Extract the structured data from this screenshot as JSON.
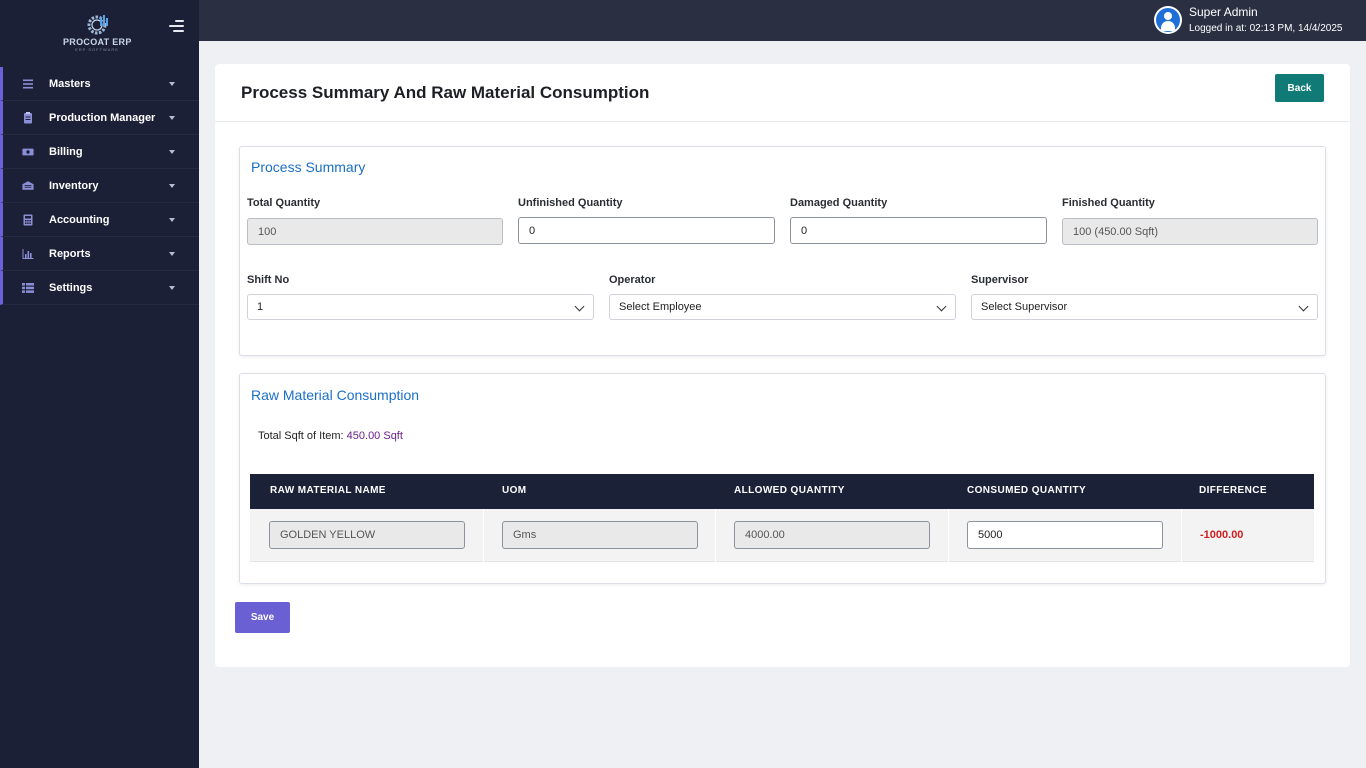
{
  "app": {
    "brand": "PROCOAT ERP",
    "brand_sub": "ERP SOFTWARE"
  },
  "sidebar": {
    "items": [
      {
        "label": "Masters",
        "icon": "list-icon"
      },
      {
        "label": "Production Manager",
        "icon": "clipboard-icon"
      },
      {
        "label": "Billing",
        "icon": "cash-icon"
      },
      {
        "label": "Inventory",
        "icon": "warehouse-icon"
      },
      {
        "label": "Accounting",
        "icon": "calculator-icon"
      },
      {
        "label": "Reports",
        "icon": "bar-chart-icon"
      },
      {
        "label": "Settings",
        "icon": "grid-list-icon"
      }
    ]
  },
  "user": {
    "name": "Super Admin",
    "login_info": "Logged in at: 02:13 PM, 14/4/2025"
  },
  "page": {
    "title": "Process Summary And Raw Material Consumption",
    "back_label": "Back",
    "save_label": "Save"
  },
  "process_summary": {
    "title": "Process Summary",
    "total_quantity": {
      "label": "Total Quantity",
      "value": "100"
    },
    "unfinished_quantity": {
      "label": "Unfinished Quantity",
      "value": "0"
    },
    "damaged_quantity": {
      "label": "Damaged Quantity",
      "value": "0"
    },
    "finished_quantity": {
      "label": "Finished Quantity",
      "value": "100 (450.00 Sqft)"
    },
    "shift_no": {
      "label": "Shift No",
      "value": "1"
    },
    "operator": {
      "label": "Operator",
      "value": "Select Employee"
    },
    "supervisor": {
      "label": "Supervisor",
      "value": "Select Supervisor"
    }
  },
  "raw_material": {
    "title": "Raw Material Consumption",
    "total_label": "Total Sqft of Item:",
    "total_value": "450.00 Sqft",
    "columns": [
      "RAW MATERIAL NAME",
      "UOM",
      "ALLOWED QUANTITY",
      "CONSUMED QUANTITY",
      "DIFFERENCE"
    ],
    "rows": [
      {
        "name": "GOLDEN YELLOW",
        "uom": "Gms",
        "allowed": "4000.00",
        "consumed": "5000",
        "difference": "-1000.00"
      }
    ]
  },
  "colors": {
    "sidebar_bg": "#1c2036",
    "topbar_bg": "#2a3042",
    "accent": "#6e60d8",
    "back_button": "#107a76",
    "save_button": "#6a5fd3",
    "difference_negative": "#d21d1d",
    "panel_title": "#1b6fc7"
  }
}
